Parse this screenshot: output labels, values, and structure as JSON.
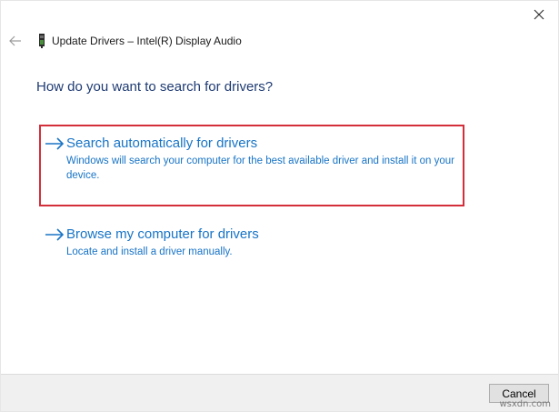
{
  "window": {
    "title": "Update Drivers – Intel(R) Display Audio"
  },
  "icons": {
    "close": "close-icon",
    "back": "back-arrow-icon",
    "device": "audio-device-icon",
    "option_arrow": "right-arrow-icon"
  },
  "main": {
    "question": "How do you want to search for drivers?",
    "options": [
      {
        "title": "Search automatically for drivers",
        "description": "Windows will search your computer for the best available driver and install it on your device.",
        "highlighted": true
      },
      {
        "title": "Browse my computer for drivers",
        "description": "Locate and install a driver manually.",
        "highlighted": false
      }
    ]
  },
  "footer": {
    "cancel_label": "Cancel"
  },
  "watermark": "wsxdn.com",
  "colors": {
    "link_blue": "#1874c6",
    "heading_blue": "#1f3b73",
    "highlight_red": "#d32f3a"
  }
}
